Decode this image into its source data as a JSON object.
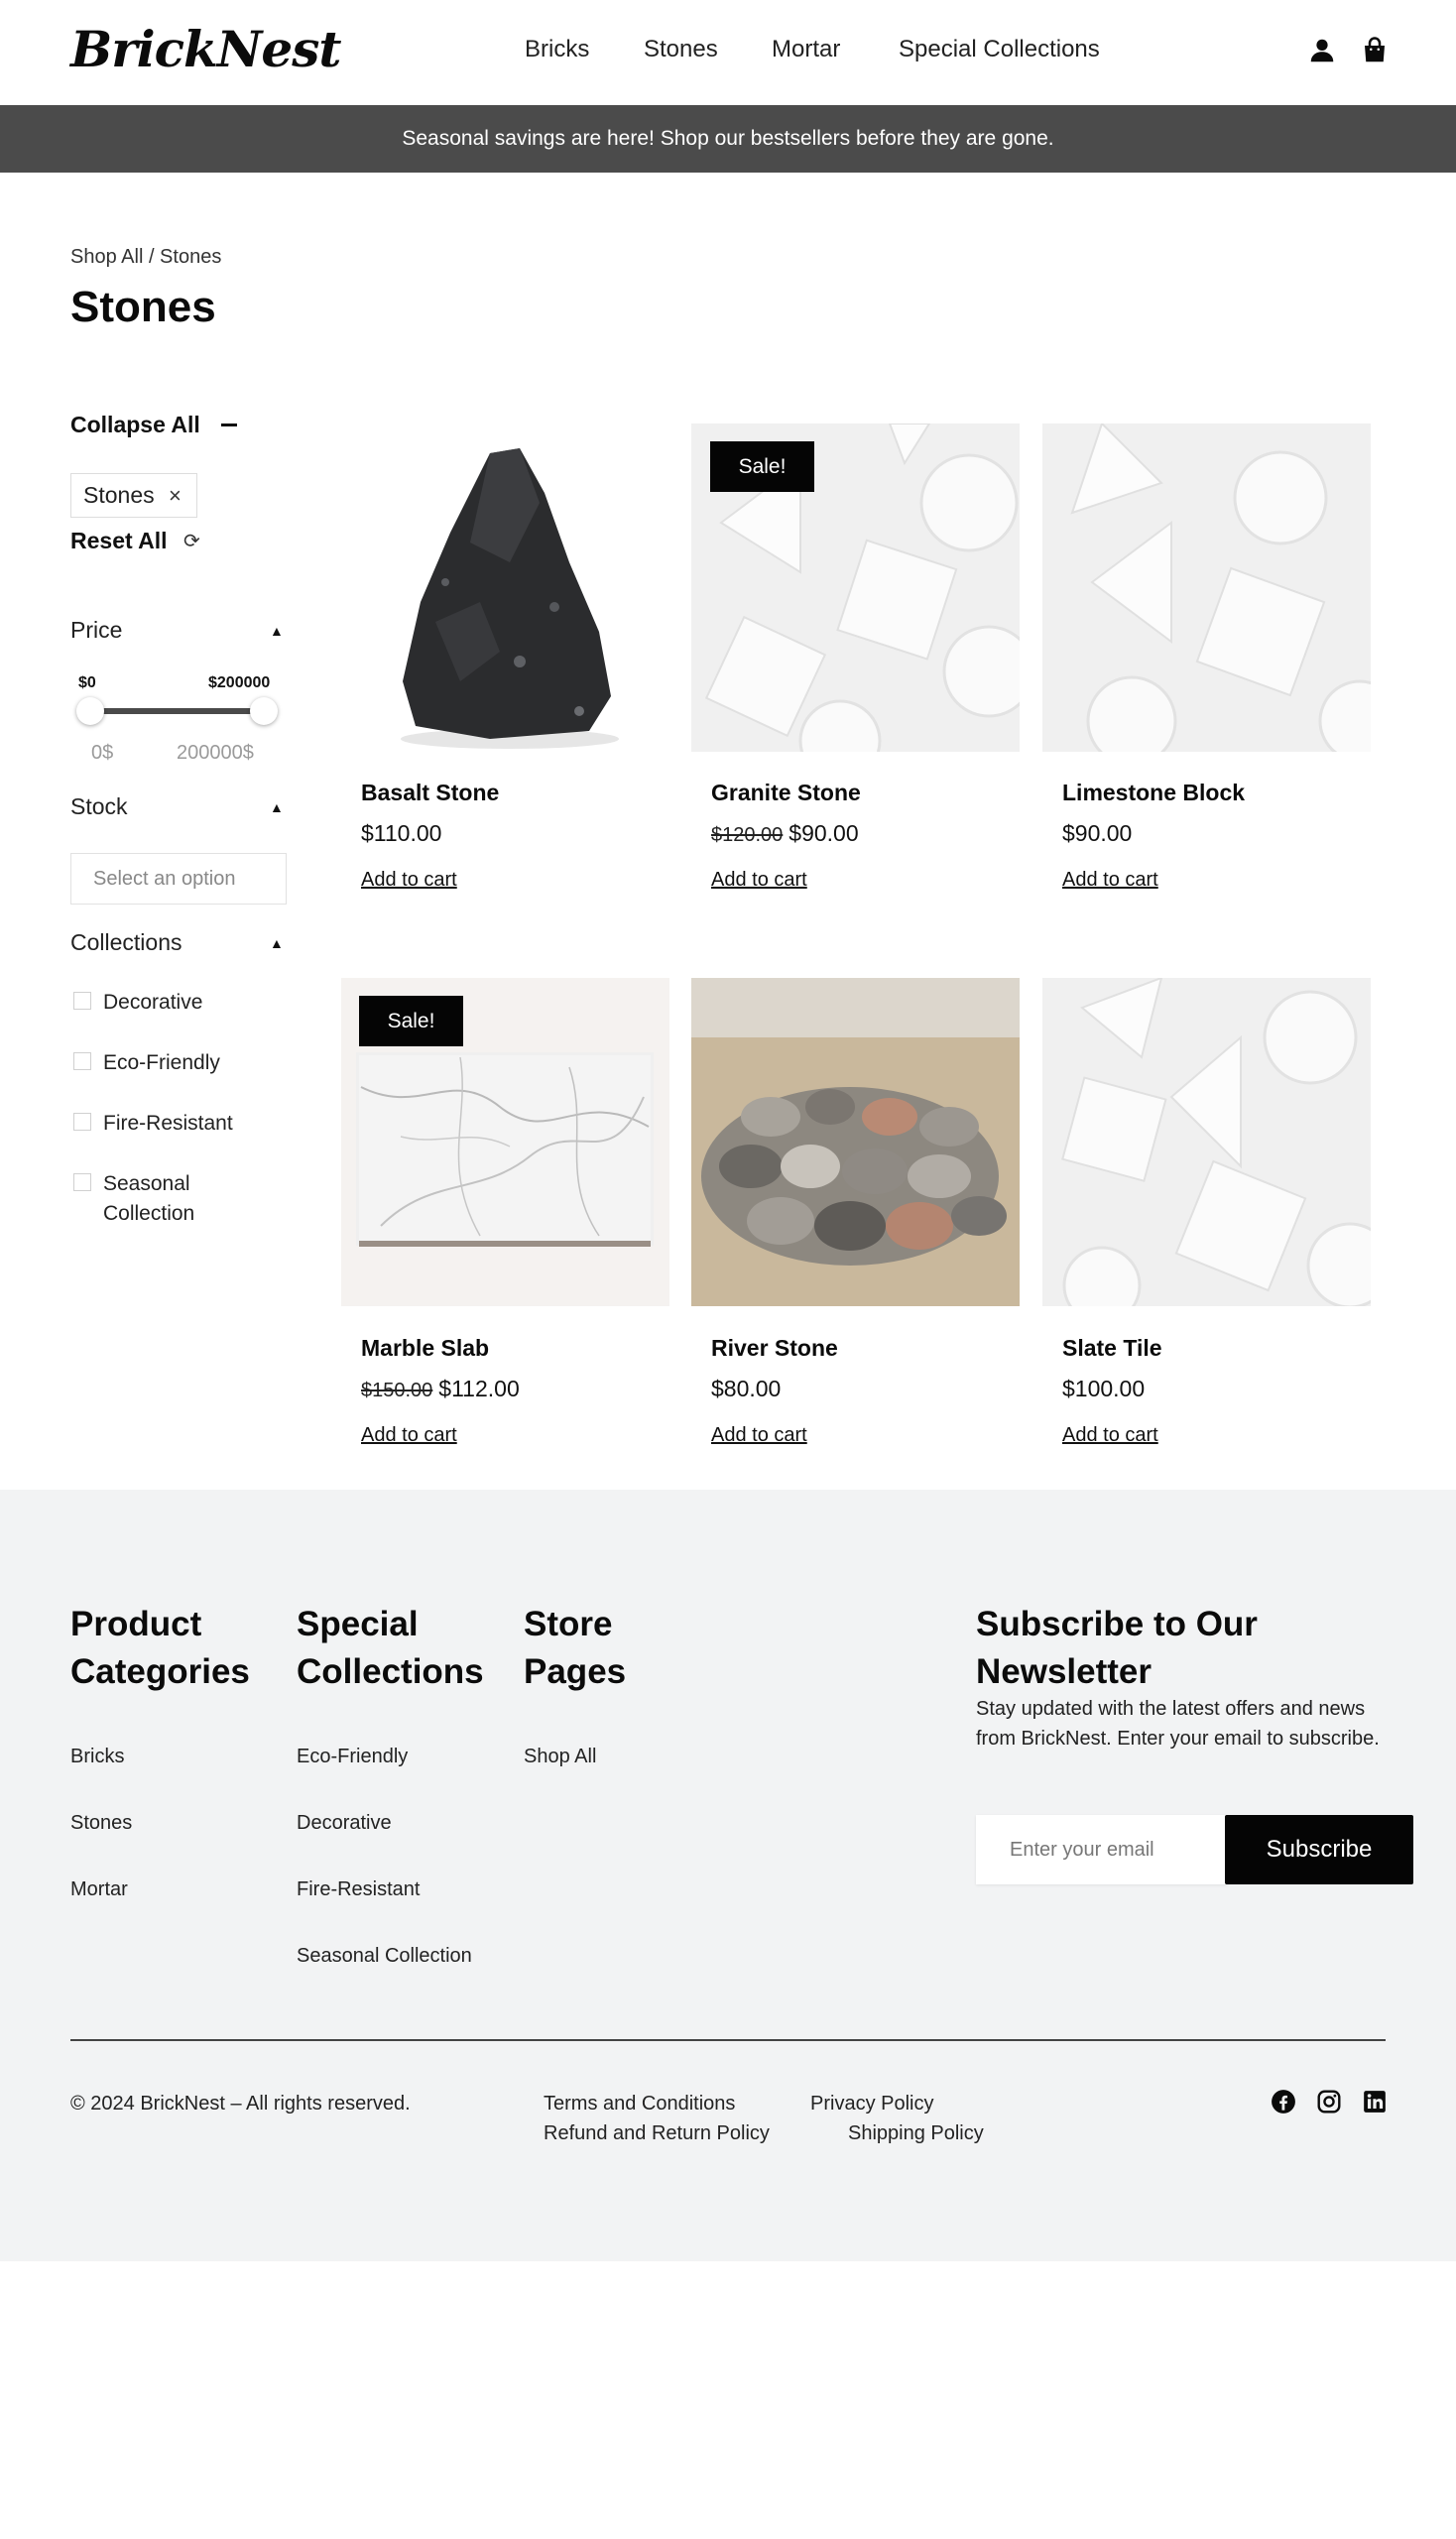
{
  "brand": {
    "logo": "BrickNest"
  },
  "nav": {
    "items": [
      "Bricks",
      "Stones",
      "Mortar",
      "Special Collections"
    ]
  },
  "header_icons": [
    "user-icon",
    "shopping-bag-icon"
  ],
  "banner": {
    "text": "Seasonal savings are here! Shop our bestsellers before they are gone."
  },
  "breadcrumb": "Shop All / Stones",
  "page_title": "Stones",
  "filters": {
    "collapse_all": "Collapse All",
    "active_chip": "Stones",
    "reset_all": "Reset All",
    "price": {
      "label": "Price",
      "min_label": "$0",
      "max_label": "$200000",
      "min_value": "0$",
      "max_value": "200000$",
      "selected_range_fraction": [
        0,
        1
      ]
    },
    "stock": {
      "label": "Stock",
      "placeholder": "Select an option"
    },
    "collections": {
      "label": "Collections",
      "items": [
        "Decorative",
        "Eco-Friendly",
        "Fire-Resistant",
        "Seasonal Collection"
      ]
    }
  },
  "products": [
    {
      "name": "Basalt Stone",
      "price": "$110.00",
      "old_price": "",
      "sale": "",
      "cta": "Add to cart"
    },
    {
      "name": "Granite Stone",
      "price": "$90.00",
      "old_price": "$120.00",
      "sale": "Sale!",
      "cta": "Add to cart"
    },
    {
      "name": "Limestone Block",
      "price": "$90.00",
      "old_price": "",
      "sale": "",
      "cta": "Add to cart"
    },
    {
      "name": "Marble Slab",
      "price": "$112.00",
      "old_price": "$150.00",
      "sale": "Sale!",
      "cta": "Add to cart"
    },
    {
      "name": "River Stone",
      "price": "$80.00",
      "old_price": "",
      "sale": "",
      "cta": "Add to cart"
    },
    {
      "name": "Slate Tile",
      "price": "$100.00",
      "old_price": "",
      "sale": "",
      "cta": "Add to cart"
    }
  ],
  "footer": {
    "product_categories": {
      "title_1": "Product",
      "title_2": "Categories",
      "links": [
        "Bricks",
        "Stones",
        "Mortar"
      ]
    },
    "special_collections": {
      "title_1": "Special",
      "title_2": "Collections",
      "links": [
        "Eco-Friendly",
        "Decorative",
        "Fire-Resistant",
        "Seasonal Collection"
      ]
    },
    "store_pages": {
      "title_1": "Store",
      "title_2": "Pages",
      "links": [
        "Shop All"
      ]
    },
    "newsletter": {
      "title_1": "Subscribe to Our",
      "title_2": "Newsletter",
      "text": "Stay updated with the latest offers and news from BrickNest. Enter your email to subscribe.",
      "placeholder": "Enter your email",
      "button": "Subscribe"
    },
    "copyright": "© 2024 BrickNest – All rights reserved.",
    "legal": [
      "Terms and Conditions",
      "Privacy Policy",
      "Refund and Return Policy",
      "Shipping Policy"
    ],
    "social_icons": [
      "facebook-icon",
      "instagram-icon",
      "linkedin-icon"
    ]
  }
}
